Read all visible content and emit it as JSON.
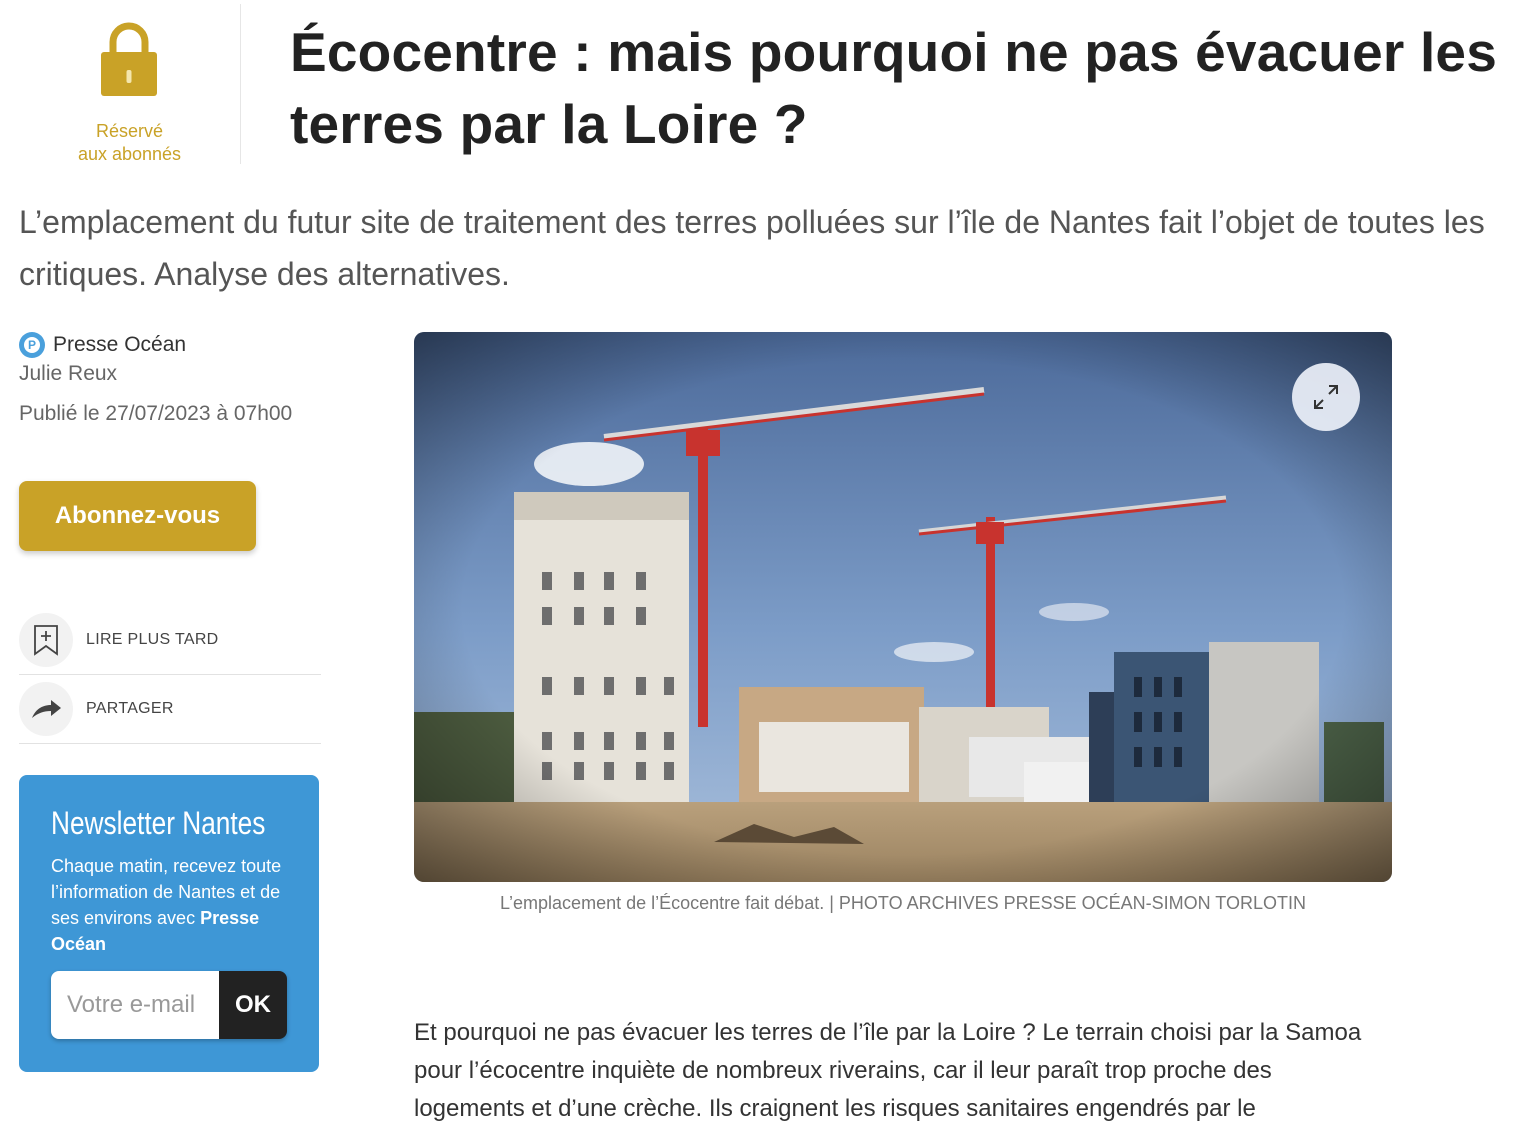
{
  "badge": {
    "lock_icon": "padlock-icon",
    "label_line1": "Réservé",
    "label_line2": "aux abonnés",
    "color": "#c9a227"
  },
  "article": {
    "title": "Écocentre : mais pourquoi ne pas évacuer les terres par la Loire ?",
    "lede": "L’emplacement du futur site de traitement des terres polluées sur l’île de Nantes fait l’objet de toutes les critiques. Analyse des alternatives.",
    "source": "Presse Océan",
    "source_icon": "P",
    "author": "Julie Reux",
    "published": "Publié le 27/07/2023 à 07h00",
    "body": "Et pourquoi ne pas évacuer les terres de l’île par la Loire ? Le terrain choisi par la Samoa pour l’écocentre inquiète de nombreux riverains, car il leur paraît trop proche des logements et d’une crèche. Ils craignent les risques sanitaires engendrés par le"
  },
  "subscribe_label": "Abonnez-vous",
  "actions": {
    "read_later": {
      "label": "LIRE PLUS TARD",
      "icon": "bookmark-plus-icon"
    },
    "share": {
      "label": "PARTAGER",
      "icon": "share-arrow-icon"
    }
  },
  "newsletter": {
    "title": "Newsletter Nantes",
    "desc_prefix": "Chaque matin, recevez toute l’information de Nantes et de ses environs avec ",
    "desc_brand": "Presse Océan",
    "input_placeholder": "Votre e-mail",
    "button_label": "OK",
    "bg_color": "#3e97d6"
  },
  "figure": {
    "caption": "L’emplacement de l’Écocentre fait débat. | PHOTO ARCHIVES PRESSE OCÉAN-SIMON TORLOTIN",
    "expand_icon": "expand-icon"
  }
}
